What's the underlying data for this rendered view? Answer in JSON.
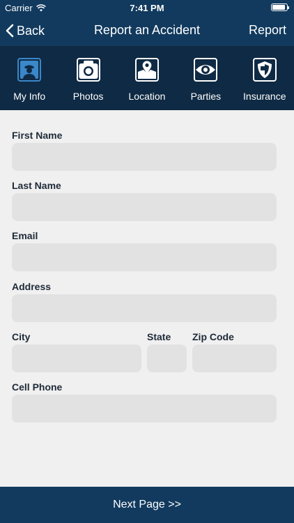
{
  "status_bar": {
    "carrier": "Carrier",
    "time": "7:41 PM",
    "battery_level": 0.9
  },
  "nav": {
    "back_label": "Back",
    "title": "Report an Accident",
    "action_label": "Report"
  },
  "tabs": [
    {
      "label": "My Info",
      "icon": "driver-icon",
      "selected": true
    },
    {
      "label": "Photos",
      "icon": "camera-icon",
      "selected": false
    },
    {
      "label": "Location",
      "icon": "map-pin-icon",
      "selected": false
    },
    {
      "label": "Parties",
      "icon": "eye-icon",
      "selected": false
    },
    {
      "label": "Insurance",
      "icon": "shield-icon",
      "selected": false
    }
  ],
  "form": {
    "first_name": {
      "label": "First Name",
      "value": ""
    },
    "last_name": {
      "label": "Last Name",
      "value": ""
    },
    "email": {
      "label": "Email",
      "value": ""
    },
    "address": {
      "label": "Address",
      "value": ""
    },
    "city": {
      "label": "City",
      "value": ""
    },
    "state": {
      "label": "State",
      "value": ""
    },
    "zip": {
      "label": "Zip Code",
      "value": ""
    },
    "cell_phone": {
      "label": "Cell Phone",
      "value": ""
    }
  },
  "footer": {
    "next_label": "Next Page >>"
  },
  "colors": {
    "header_bg": "#113a5e",
    "tab_bg": "#0f2a44",
    "selected_icon": "#3a87c9",
    "field_bg": "#e2e2e2",
    "page_bg": "#f0f0f0"
  }
}
